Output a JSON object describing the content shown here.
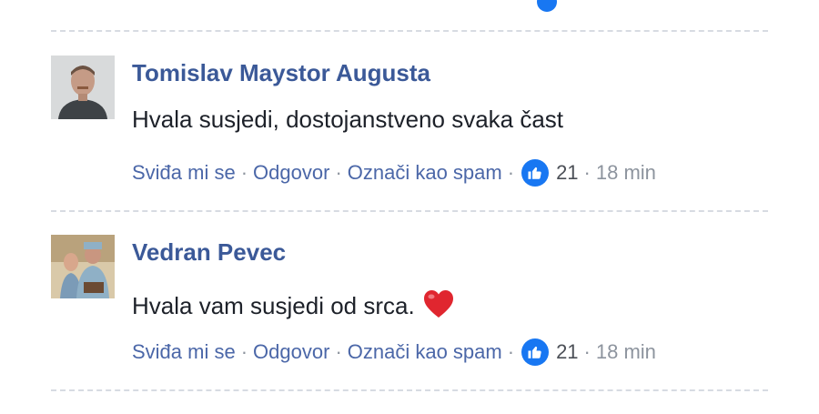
{
  "colors": {
    "link": "#4b67a8",
    "author": "#3b5998",
    "text": "#1d2129",
    "muted": "#8d949e",
    "like_badge": "#1877f2",
    "heart": "#e0262f"
  },
  "comments": [
    {
      "author": "Tomislav Maystor Augusta",
      "text": "Hvala susjedi, dostojanstveno svaka čast",
      "emoji": null,
      "actions": {
        "like": "Sviđa mi se",
        "reply": "Odgovor",
        "spam": "Označi kao spam"
      },
      "reaction_icon": "thumbs-up-icon",
      "like_count": "21",
      "time": "18 min"
    },
    {
      "author": "Vedran Pevec",
      "text": "Hvala vam susjedi od srca.",
      "emoji": "heart-icon",
      "actions": {
        "like": "Sviđa mi se",
        "reply": "Odgovor",
        "spam": "Označi kao spam"
      },
      "reaction_icon": "thumbs-up-icon",
      "like_count": "21",
      "time": "18 min"
    }
  ]
}
